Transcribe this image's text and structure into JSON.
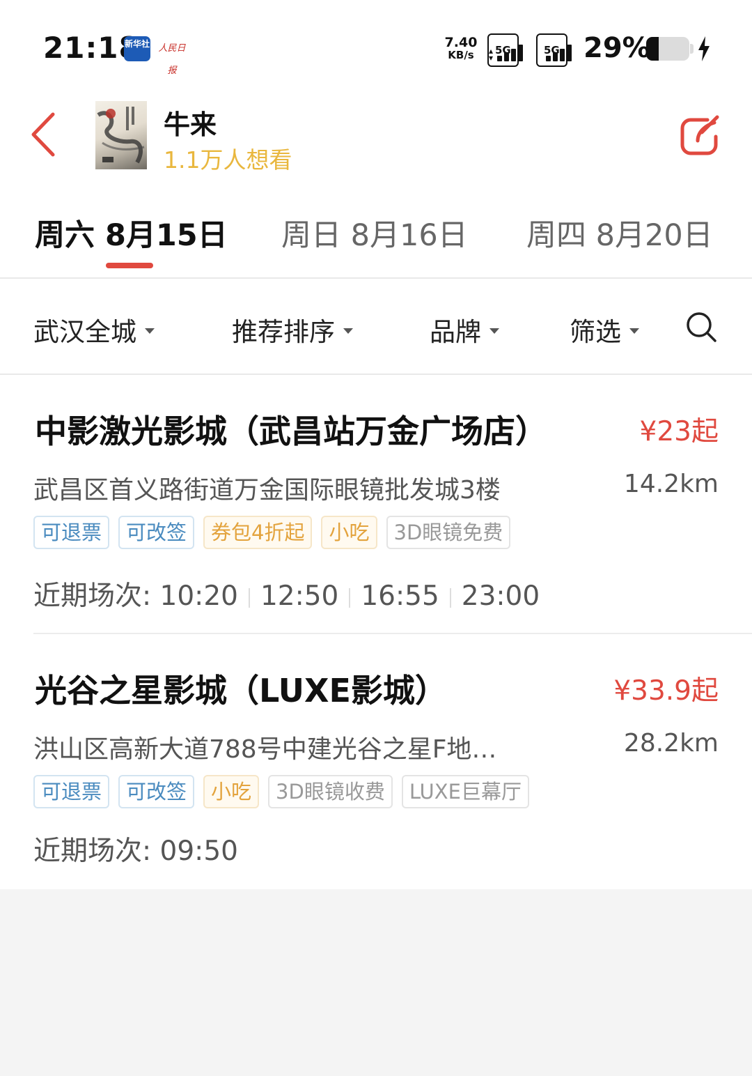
{
  "status_bar": {
    "time": "21:18",
    "app_badge_1": "新华社",
    "app_badge_2": "人民日报",
    "net_speed_value": "7.40",
    "net_speed_unit": "KB/s",
    "signal_1_label": "5G",
    "signal_2_label": "5G",
    "battery_percent": "29%",
    "battery_level": 0.29,
    "charging": true
  },
  "header": {
    "movie_title": "牛来",
    "want_to_see": "1.1万人想看",
    "poster_alt": "movie-poster"
  },
  "date_tabs": [
    {
      "label": "周六 8月15日",
      "active": true
    },
    {
      "label": "周日 8月16日",
      "active": false
    },
    {
      "label": "周四 8月20日",
      "active": false
    }
  ],
  "filters": {
    "city": "武汉全城",
    "sort": "推荐排序",
    "brand": "品牌",
    "filter": "筛选"
  },
  "cinemas": [
    {
      "name": "中影激光影城（武昌站万金广场店）",
      "price": "¥23起",
      "address": "武昌区首义路街道万金国际眼镜批发城3楼",
      "distance": "14.2km",
      "tags": [
        {
          "label": "可退票",
          "style": "blue"
        },
        {
          "label": "可改签",
          "style": "blue"
        },
        {
          "label": "券包4折起",
          "style": "orange"
        },
        {
          "label": "小吃",
          "style": "orange"
        },
        {
          "label": "3D眼镜免费",
          "style": "gray"
        }
      ],
      "showtimes_label": "近期场次:",
      "showtimes": [
        "10:20",
        "12:50",
        "16:55",
        "23:00"
      ]
    },
    {
      "name": "光谷之星影城（LUXE影城）",
      "price": "¥33.9起",
      "address": "洪山区高新大道788号中建光谷之星F地…",
      "distance": "28.2km",
      "tags": [
        {
          "label": "可退票",
          "style": "blue"
        },
        {
          "label": "可改签",
          "style": "blue"
        },
        {
          "label": "小吃",
          "style": "orange"
        },
        {
          "label": "3D眼镜收费",
          "style": "gray"
        },
        {
          "label": "LUXE巨幕厅",
          "style": "gray"
        }
      ],
      "showtimes_label": "近期场次:",
      "showtimes": [
        "09:50"
      ]
    }
  ],
  "colors": {
    "accent_red": "#e0493f",
    "want_yellow": "#e9b73e",
    "tag_blue": "#4a8bbf",
    "tag_orange": "#e3a33d"
  }
}
